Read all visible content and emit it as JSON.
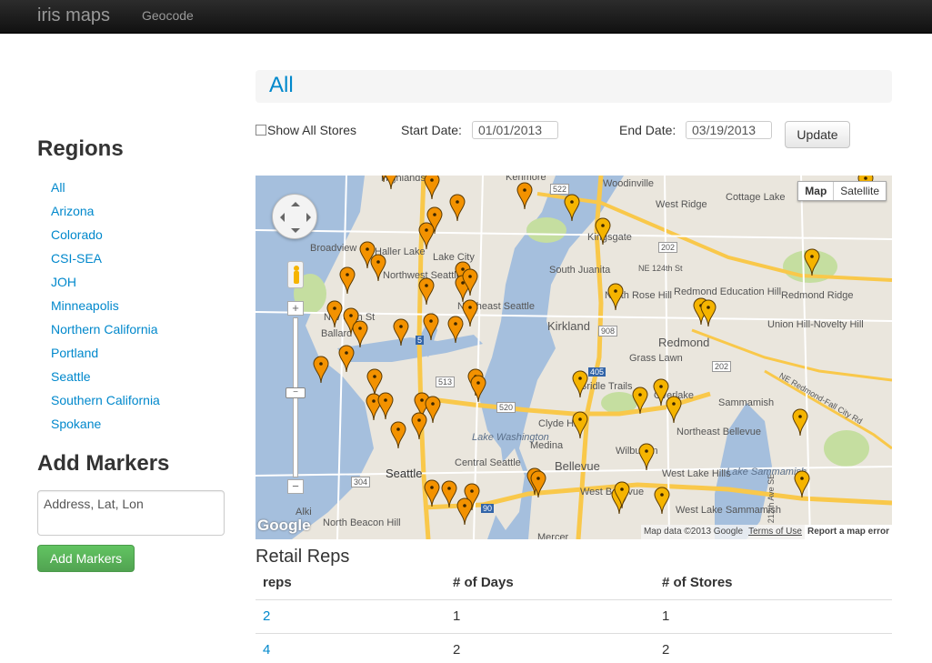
{
  "navbar": {
    "brand": "iris maps",
    "links": [
      "Geocode"
    ]
  },
  "sidebar": {
    "regions_title": "Regions",
    "regions": [
      "All",
      "Arizona",
      "Colorado",
      "CSI-SEA",
      "JOH",
      "Minneapolis",
      "Northern California",
      "Portland",
      "Seattle",
      "Southern California",
      "Spokane"
    ],
    "add_markers_title": "Add Markers",
    "markers_placeholder": "Address, Lat, Lon",
    "add_markers_button": "Add Markers"
  },
  "main": {
    "region_title": "All",
    "filters": {
      "show_all_label": "Show All Stores",
      "start_label": "Start Date:",
      "start_value": "01/01/2013",
      "end_label": "End Date:",
      "end_value": "03/19/2013",
      "update_button": "Update"
    }
  },
  "map": {
    "type_buttons": [
      "Map",
      "Satellite"
    ],
    "active_type": "Map",
    "place_labels": [
      "Highlands",
      "Kenmore",
      "Woodinville",
      "Cottage Lake",
      "West Ridge",
      "Kingsgate",
      "South Juanita",
      "Haller Lake",
      "Lake City",
      "Broadview",
      "Northwest Seattle",
      "Northeast Seattle",
      "NW 80th St",
      "Ballard",
      "North Rose Hill",
      "Redmond Education Hill",
      "Redmond",
      "Redmond Ridge",
      "Union Hill-Novelty Hill",
      "Kirkland",
      "Grass Lawn",
      "Bridle Trails",
      "Overlake",
      "Clyde Hill",
      "Sammamish",
      "Northeast Bellevue",
      "Lake Washington",
      "Medina",
      "Bellevue",
      "Wilburton",
      "Central Seattle",
      "Seattle",
      "West Lake Hills",
      "Lake Sammamish",
      "West Bellevue",
      "West Lake Sammamish",
      "North Beacon Hill",
      "Alki",
      "Mercer",
      "NE 124th St",
      "NE Redmond-Fall City Rd",
      "212th Ave SE"
    ],
    "highway_shields": [
      "522",
      "202",
      "908",
      "405",
      "202",
      "520",
      "513",
      "304",
      "90",
      "5"
    ],
    "google_logo": "Google",
    "attribution": "Map data ©2013 Google",
    "terms": "Terms of Use",
    "report": "Report a map error",
    "colors": {
      "marker": "#f39200",
      "marker_alt": "#f5b400",
      "water": "#a5bfdd",
      "land": "#eae6dd",
      "park": "#c5dea0",
      "highway": "#f9c84a"
    }
  },
  "reps_table": {
    "title": "Retail Reps",
    "headers": [
      "reps",
      "# of Days",
      "# of Stores"
    ],
    "rows": [
      [
        "2",
        "1",
        "1"
      ],
      [
        "4",
        "2",
        "2"
      ]
    ]
  }
}
